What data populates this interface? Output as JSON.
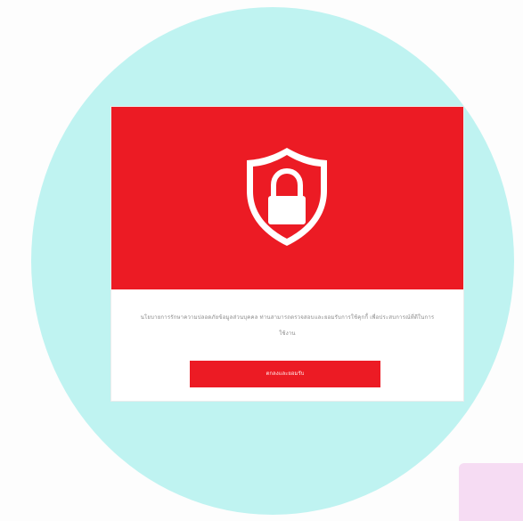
{
  "dialog": {
    "icon": "shield-lock-icon",
    "message": "นโยบายการรักษาความปลอดภัยข้อมูลส่วนบุคคล ท่านสามารถตรวจสอบและยอมรับการใช้คุกกี้ เพื่อประสบการณ์ที่ดีในการใช้งาน",
    "button_label": "ตกลงและยอมรับ"
  },
  "colors": {
    "brand_red": "#ec1b24",
    "background_circle": "#bff3f1",
    "corner_accent": "#f6dcf3"
  }
}
